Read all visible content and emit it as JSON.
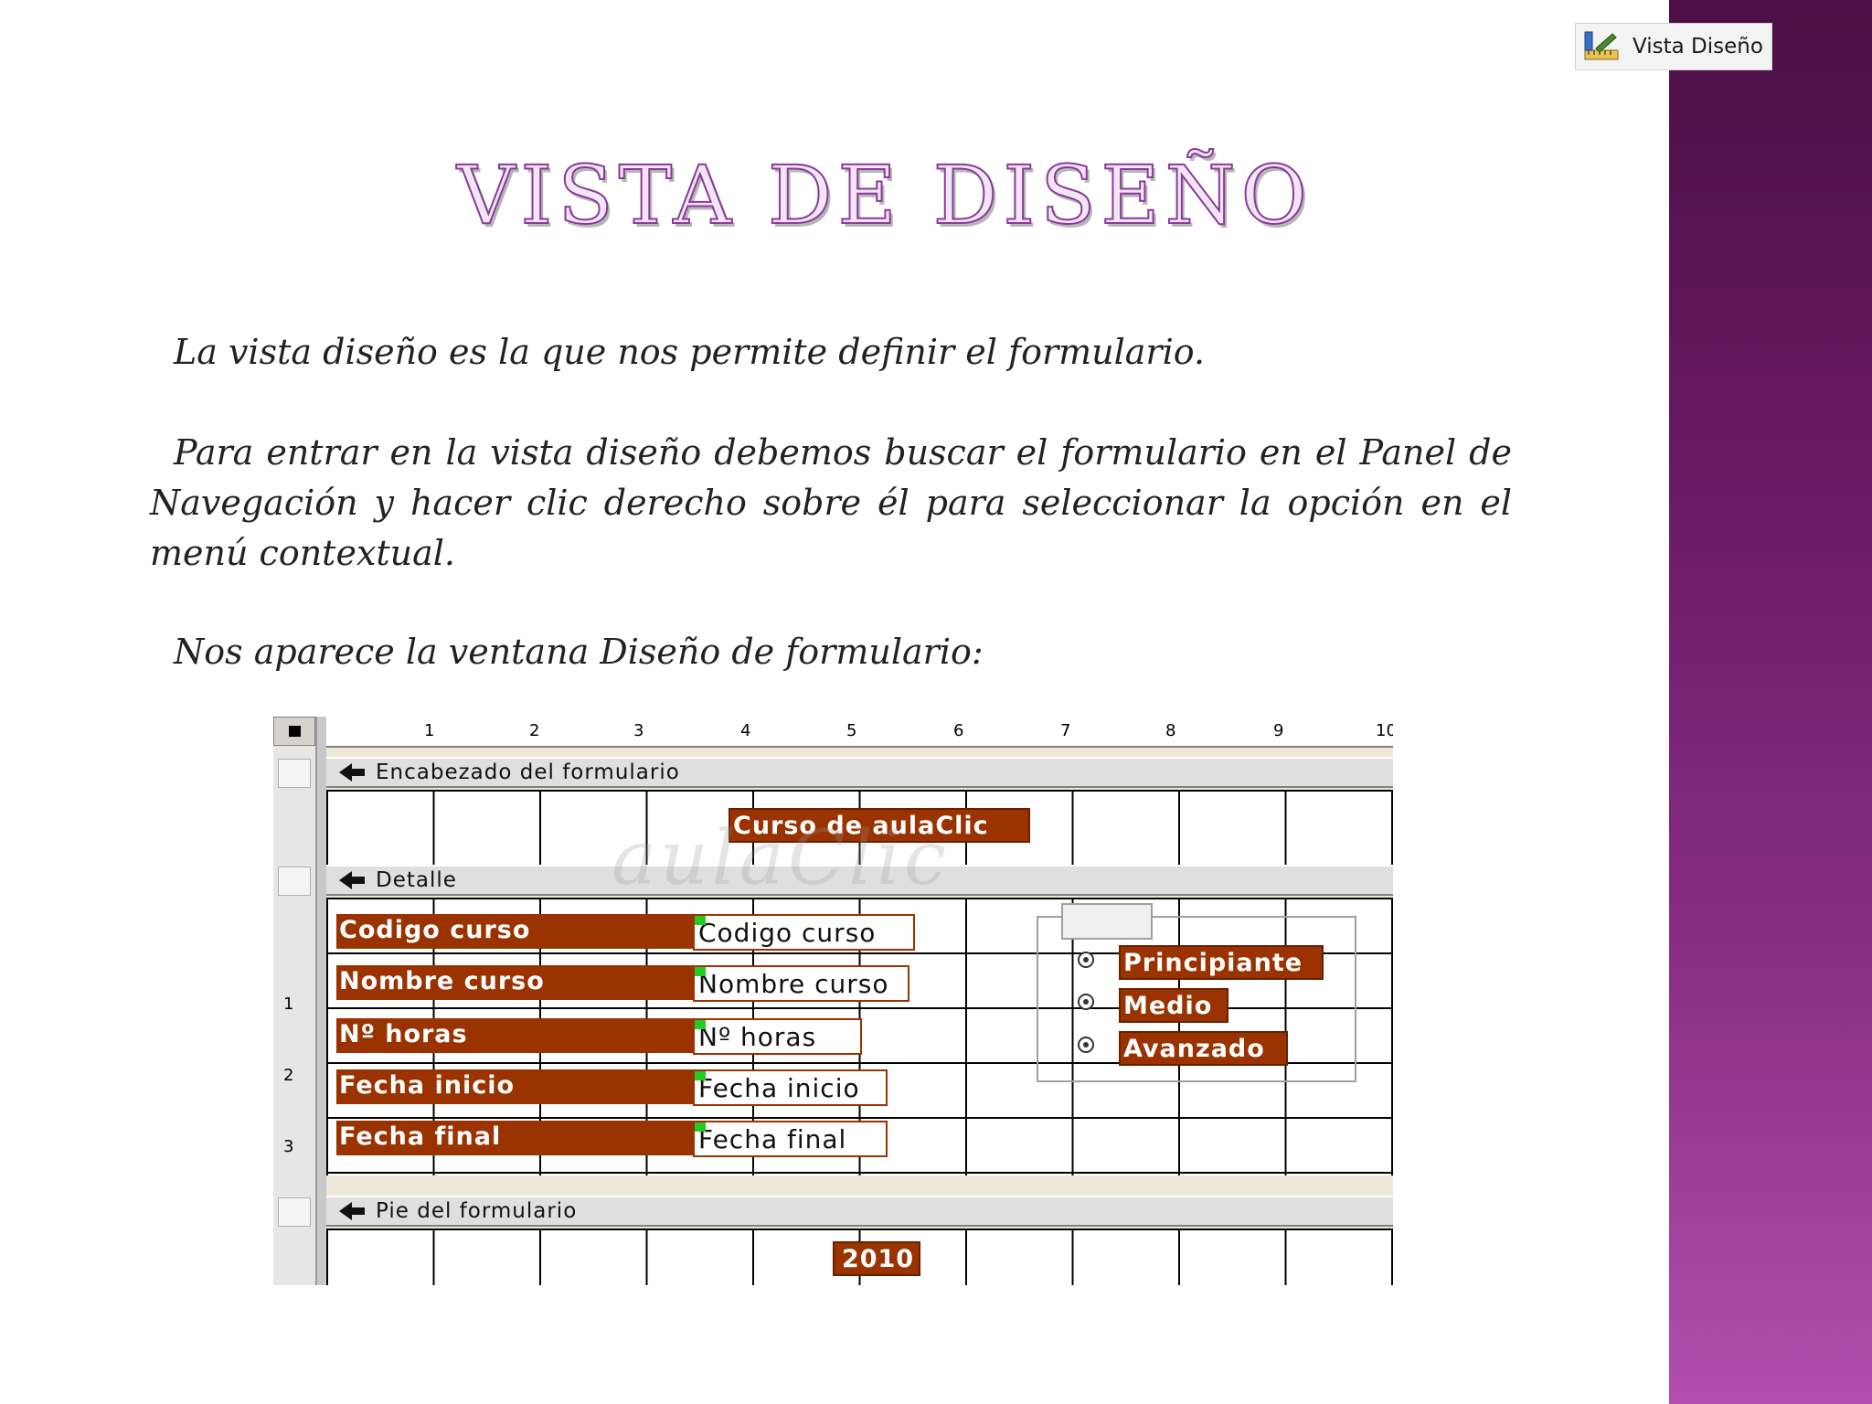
{
  "button": {
    "label": "Vista Diseño",
    "icon": "design-view-icon"
  },
  "title": "VISTA DE DISEÑO",
  "paragraphs": {
    "p1": "La vista diseño es la que nos permite definir el formulario.",
    "p2": "Para entrar en la vista diseño debemos buscar el formulario en el Panel de Navegación y hacer clic derecho sobre él para seleccionar la opción en el menú contextual.",
    "p3": "Nos aparece la ventana Diseño de formulario:"
  },
  "designer": {
    "ruler_numbers": [
      "1",
      "2",
      "3",
      "4",
      "5",
      "6",
      "7",
      "8",
      "9",
      "10"
    ],
    "vruler_numbers": [
      "1",
      "2",
      "3"
    ],
    "bands": {
      "header": "Encabezado del formulario",
      "detail": "Detalle",
      "footer": "Pie del formulario"
    },
    "header_label": "Curso de aulaClic",
    "fields": [
      {
        "label": "Codigo curso",
        "value": "Codigo curso"
      },
      {
        "label": "Nombre curso",
        "value": "Nombre curso"
      },
      {
        "label": "Nº horas",
        "value": "Nº horas"
      },
      {
        "label": "Fecha inicio",
        "value": "Fecha inicio"
      },
      {
        "label": "Fecha final",
        "value": "Fecha final"
      }
    ],
    "options": [
      "Principiante",
      "Medio",
      "Avanzado"
    ],
    "footer_label": "2010",
    "watermark": "aulaClic"
  },
  "colors": {
    "label_bg": "#9a3300",
    "title_stroke": "#8a3a9a",
    "band_gradient_top": "#4a0f45",
    "band_gradient_bottom": "#b24fae"
  }
}
